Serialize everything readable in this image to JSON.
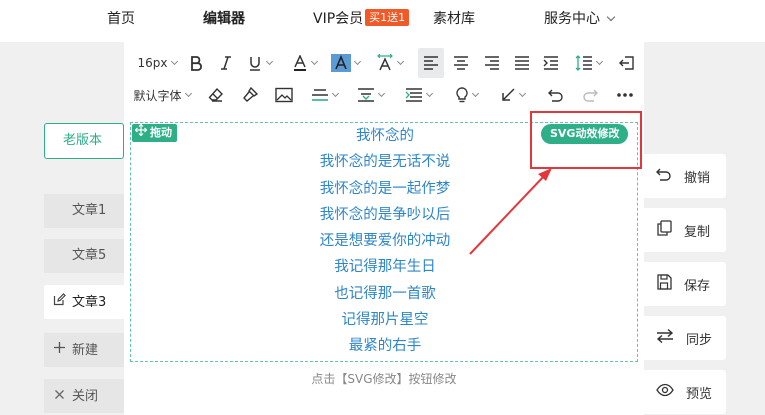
{
  "nav": {
    "home": "首页",
    "editor": "编辑器",
    "vip": "VIP会员",
    "vip_badge": "买1送1",
    "materials": "素材库",
    "service": "服务中心"
  },
  "sidebar": {
    "old_version": "老版本",
    "items": [
      {
        "label": "文章1",
        "icon": "none"
      },
      {
        "label": "文章5",
        "icon": "none"
      },
      {
        "label": "文章3",
        "icon": "edit-icon"
      },
      {
        "label": "新建",
        "icon": "plus-icon"
      },
      {
        "label": "关闭",
        "icon": "close-icon"
      }
    ]
  },
  "toolbar": {
    "font_size": "16px",
    "font_family": "默认字体"
  },
  "content": {
    "drag_label": "拖动",
    "svg_button": "SVG动效修改",
    "text_color": "#2e86c9",
    "poem": [
      "我怀念的",
      "我怀念的是无话不说",
      "我怀念的是一起作梦",
      "我怀念的是争吵以后",
      "还是想要爱你的冲动",
      "我记得那年生日",
      "也记得那一首歌",
      "记得那片星空",
      "最紧的右手"
    ],
    "hint": "点击【SVG修改】按钮修改"
  },
  "actions": [
    {
      "label": "撤销",
      "icon": "undo-icon"
    },
    {
      "label": "复制",
      "icon": "copy-icon"
    },
    {
      "label": "保存",
      "icon": "save-icon"
    },
    {
      "label": "同步",
      "icon": "sync-icon"
    },
    {
      "label": "预览",
      "icon": "eye-icon"
    }
  ],
  "colors": {
    "accent": "#2eaf88",
    "highlight_frame": "#e3373c",
    "badge": "#f05a28"
  }
}
